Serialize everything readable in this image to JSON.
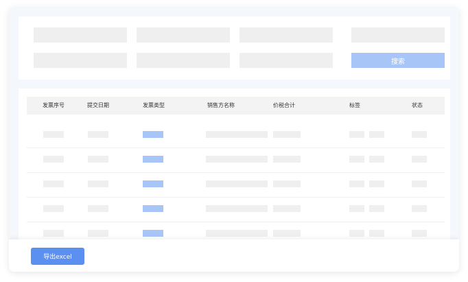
{
  "filters": {
    "search_label": "搜索"
  },
  "table": {
    "columns": [
      "发票序号",
      "提交日期",
      "发票类型",
      "销售方名称",
      "价税合计",
      "标签",
      "状态"
    ],
    "row_count": 5
  },
  "footer": {
    "export_label": "导出excel"
  },
  "colors": {
    "accent": "#5b8ff0",
    "accent_light": "#a8c5f7",
    "placeholder": "#efefef"
  }
}
